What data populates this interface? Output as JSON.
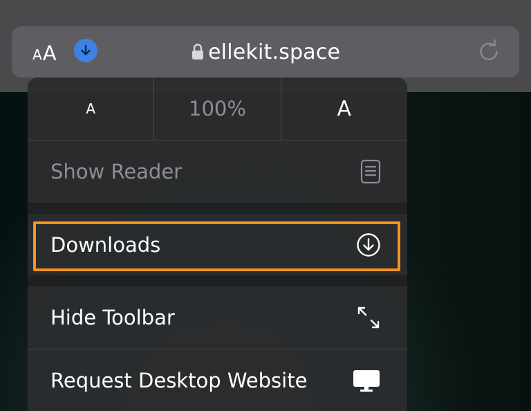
{
  "addressbar": {
    "text_size_small": "A",
    "text_size_large": "A",
    "url": "ellekit.space",
    "icons": {
      "download": "download-arrow-icon",
      "lock": "lock-icon",
      "reload": "reload-icon"
    }
  },
  "menu": {
    "zoom": {
      "decrease": "A",
      "level": "100%",
      "increase": "A"
    },
    "items": [
      {
        "label": "Show Reader",
        "icon": "reader-icon",
        "enabled": false
      },
      {
        "label": "Downloads",
        "icon": "download-circle-icon",
        "enabled": true,
        "highlighted": true
      },
      {
        "label": "Hide Toolbar",
        "icon": "expand-arrows-icon",
        "enabled": true
      },
      {
        "label": "Request Desktop Website",
        "icon": "desktop-icon",
        "enabled": true
      }
    ]
  },
  "colors": {
    "accent_blue": "#3d82e6",
    "highlight_orange": "#f7941d",
    "menu_bg": "#2a2c2e",
    "addressbar_bg": "#5e5e62"
  }
}
